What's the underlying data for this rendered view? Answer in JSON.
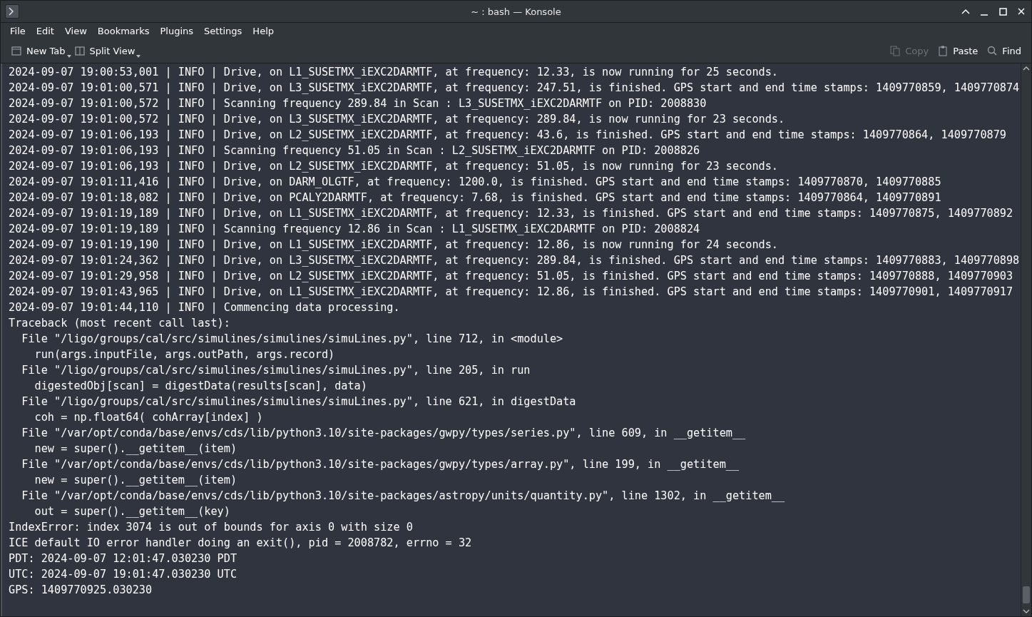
{
  "window": {
    "title": "~ : bash — Konsole"
  },
  "menu": [
    "File",
    "Edit",
    "View",
    "Bookmarks",
    "Plugins",
    "Settings",
    "Help"
  ],
  "toolbar_left": [
    {
      "label": "New Tab",
      "kind": "tab",
      "dropdown": true
    },
    {
      "label": "Split View",
      "kind": "split",
      "dropdown": true
    }
  ],
  "toolbar_right": [
    {
      "label": "Copy",
      "kind": "copy",
      "disabled": true
    },
    {
      "label": "Paste",
      "kind": "paste",
      "disabled": false
    },
    {
      "label": "Find",
      "kind": "find",
      "disabled": false
    }
  ],
  "terminal_lines": [
    "2024-09-07 19:00:53,001 | INFO | Drive, on L1_SUSETMX_iEXC2DARMTF, at frequency: 12.33, is now running for 25 seconds.",
    "2024-09-07 19:01:00,571 | INFO | Drive, on L3_SUSETMX_iEXC2DARMTF, at frequency: 247.51, is finished. GPS start and end time stamps: 1409770859, 1409770874",
    "2024-09-07 19:01:00,572 | INFO | Scanning frequency 289.84 in Scan : L3_SUSETMX_iEXC2DARMTF on PID: 2008830",
    "2024-09-07 19:01:00,572 | INFO | Drive, on L3_SUSETMX_iEXC2DARMTF, at frequency: 289.84, is now running for 23 seconds.",
    "2024-09-07 19:01:06,193 | INFO | Drive, on L2_SUSETMX_iEXC2DARMTF, at frequency: 43.6, is finished. GPS start and end time stamps: 1409770864, 1409770879",
    "2024-09-07 19:01:06,193 | INFO | Scanning frequency 51.05 in Scan : L2_SUSETMX_iEXC2DARMTF on PID: 2008826",
    "2024-09-07 19:01:06,193 | INFO | Drive, on L2_SUSETMX_iEXC2DARMTF, at frequency: 51.05, is now running for 23 seconds.",
    "2024-09-07 19:01:11,416 | INFO | Drive, on DARM_OLGTF, at frequency: 1200.0, is finished. GPS start and end time stamps: 1409770870, 1409770885",
    "2024-09-07 19:01:18,082 | INFO | Drive, on PCALY2DARMTF, at frequency: 7.68, is finished. GPS start and end time stamps: 1409770864, 1409770891",
    "2024-09-07 19:01:19,189 | INFO | Drive, on L1_SUSETMX_iEXC2DARMTF, at frequency: 12.33, is finished. GPS start and end time stamps: 1409770875, 1409770892",
    "2024-09-07 19:01:19,189 | INFO | Scanning frequency 12.86 in Scan : L1_SUSETMX_iEXC2DARMTF on PID: 2008824",
    "2024-09-07 19:01:19,190 | INFO | Drive, on L1_SUSETMX_iEXC2DARMTF, at frequency: 12.86, is now running for 24 seconds.",
    "2024-09-07 19:01:24,362 | INFO | Drive, on L3_SUSETMX_iEXC2DARMTF, at frequency: 289.84, is finished. GPS start and end time stamps: 1409770883, 1409770898",
    "2024-09-07 19:01:29,958 | INFO | Drive, on L2_SUSETMX_iEXC2DARMTF, at frequency: 51.05, is finished. GPS start and end time stamps: 1409770888, 1409770903",
    "2024-09-07 19:01:43,965 | INFO | Drive, on L1_SUSETMX_iEXC2DARMTF, at frequency: 12.86, is finished. GPS start and end time stamps: 1409770901, 1409770917",
    "2024-09-07 19:01:44,110 | INFO | Commencing data processing.",
    "Traceback (most recent call last):",
    "  File \"/ligo/groups/cal/src/simulines/simulines/simuLines.py\", line 712, in <module>",
    "    run(args.inputFile, args.outPath, args.record)",
    "  File \"/ligo/groups/cal/src/simulines/simulines/simuLines.py\", line 205, in run",
    "    digestedObj[scan] = digestData(results[scan], data)",
    "  File \"/ligo/groups/cal/src/simulines/simulines/simuLines.py\", line 621, in digestData",
    "    coh = np.float64( cohArray[index] )",
    "  File \"/var/opt/conda/base/envs/cds/lib/python3.10/site-packages/gwpy/types/series.py\", line 609, in __getitem__",
    "    new = super().__getitem__(item)",
    "  File \"/var/opt/conda/base/envs/cds/lib/python3.10/site-packages/gwpy/types/array.py\", line 199, in __getitem__",
    "    new = super().__getitem__(item)",
    "  File \"/var/opt/conda/base/envs/cds/lib/python3.10/site-packages/astropy/units/quantity.py\", line 1302, in __getitem__",
    "    out = super().__getitem__(key)",
    "IndexError: index 3074 is out of bounds for axis 0 with size 0",
    "ICE default IO error handler doing an exit(), pid = 2008782, errno = 32",
    "PDT: 2024-09-07 12:01:47.030230 PDT",
    "UTC: 2024-09-07 19:01:47.030230 UTC",
    "GPS: 1409770925.030230"
  ]
}
